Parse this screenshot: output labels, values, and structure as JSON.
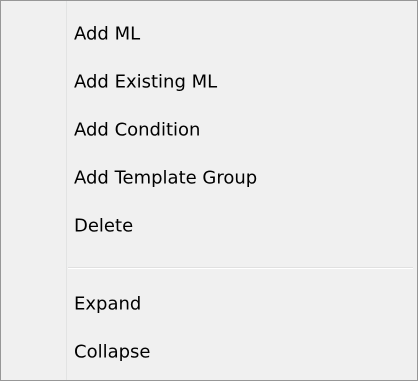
{
  "context_menu": {
    "items": [
      {
        "label": "Add ML"
      },
      {
        "label": "Add Existing ML"
      },
      {
        "label": "Add Condition"
      },
      {
        "label": "Add Template Group"
      },
      {
        "label": "Delete"
      },
      {
        "label": "Expand"
      },
      {
        "label": "Collapse"
      }
    ]
  },
  "colors": {
    "background": "#f0f0f0",
    "border": "#979797",
    "text": "#000000"
  }
}
